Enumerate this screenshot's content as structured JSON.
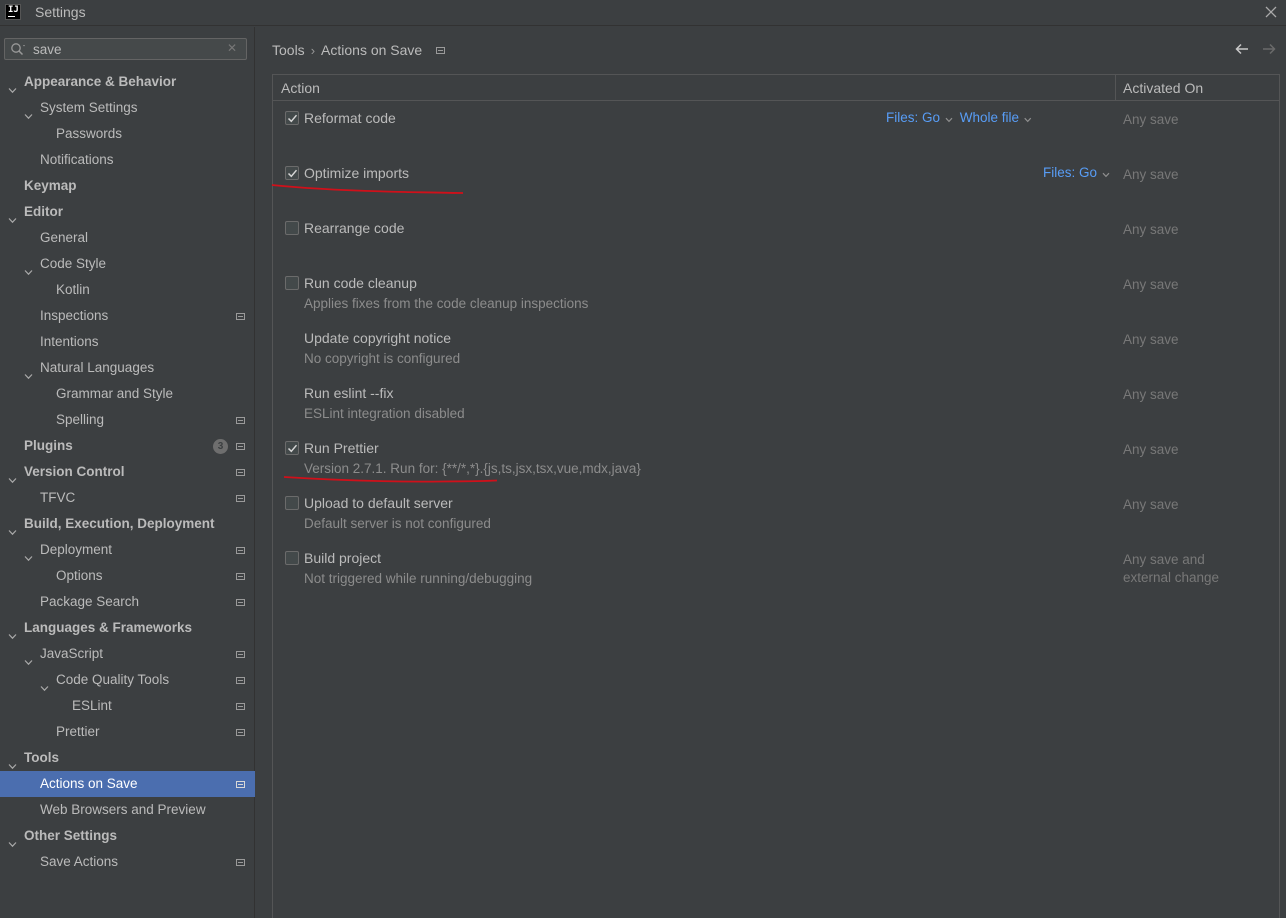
{
  "window": {
    "title": "Settings",
    "logo_text": "IJ"
  },
  "search": {
    "value": "save",
    "placeholder": ""
  },
  "tree": [
    {
      "label": "Appearance & Behavior",
      "level": 0,
      "arrow": "down",
      "bold": true
    },
    {
      "label": "System Settings",
      "level": 1,
      "arrow": "down"
    },
    {
      "label": "Passwords",
      "level": 2
    },
    {
      "label": "Notifications",
      "level": 1
    },
    {
      "label": "Keymap",
      "level": 0,
      "bold": true
    },
    {
      "label": "Editor",
      "level": 0,
      "arrow": "down",
      "bold": true
    },
    {
      "label": "General",
      "level": 1
    },
    {
      "label": "Code Style",
      "level": 1,
      "arrow": "down"
    },
    {
      "label": "Kotlin",
      "level": 2
    },
    {
      "label": "Inspections",
      "level": 1,
      "marker": true
    },
    {
      "label": "Intentions",
      "level": 1
    },
    {
      "label": "Natural Languages",
      "level": 1,
      "arrow": "down"
    },
    {
      "label": "Grammar and Style",
      "level": 2
    },
    {
      "label": "Spelling",
      "level": 2,
      "marker": true
    },
    {
      "label": "Plugins",
      "level": 0,
      "bold": true,
      "badge": "3",
      "marker": true
    },
    {
      "label": "Version Control",
      "level": 0,
      "arrow": "down",
      "bold": true,
      "marker": true
    },
    {
      "label": "TFVC",
      "level": 1,
      "marker": true
    },
    {
      "label": "Build, Execution, Deployment",
      "level": 0,
      "arrow": "down",
      "bold": true
    },
    {
      "label": "Deployment",
      "level": 1,
      "arrow": "down",
      "marker": true
    },
    {
      "label": "Options",
      "level": 2,
      "marker": true
    },
    {
      "label": "Package Search",
      "level": 1,
      "marker": true
    },
    {
      "label": "Languages & Frameworks",
      "level": 0,
      "arrow": "down",
      "bold": true
    },
    {
      "label": "JavaScript",
      "level": 1,
      "arrow": "down",
      "marker": true
    },
    {
      "label": "Code Quality Tools",
      "level": 2,
      "arrow": "down",
      "marker": true
    },
    {
      "label": "ESLint",
      "level": 3,
      "marker": true
    },
    {
      "label": "Prettier",
      "level": 2,
      "marker": true
    },
    {
      "label": "Tools",
      "level": 0,
      "arrow": "down",
      "bold": true
    },
    {
      "label": "Actions on Save",
      "level": 1,
      "marker": true,
      "selected": true
    },
    {
      "label": "Web Browsers and Preview",
      "level": 1
    },
    {
      "label": "Other Settings",
      "level": 0,
      "arrow": "down",
      "bold": true
    },
    {
      "label": "Save Actions",
      "level": 1,
      "marker": true
    }
  ],
  "breadcrumb": {
    "parent": "Tools",
    "current": "Actions on Save"
  },
  "table": {
    "col_action": "Action",
    "col_activated": "Activated On",
    "rows": [
      {
        "title": "Reformat code",
        "subtitle": "",
        "checkbox": true,
        "checked": true,
        "activated": "Any save",
        "dropdowns": [
          "Files: Go",
          "Whole file"
        ]
      },
      {
        "title": "Optimize imports",
        "subtitle": "",
        "checkbox": true,
        "checked": true,
        "activated": "Any save",
        "dropdowns": [
          "Files: Go"
        ]
      },
      {
        "title": "Rearrange code",
        "subtitle": "",
        "checkbox": true,
        "checked": false,
        "activated": "Any save",
        "dropdowns": []
      },
      {
        "title": "Run code cleanup",
        "subtitle": "Applies fixes from the code cleanup inspections",
        "checkbox": true,
        "checked": false,
        "activated": "Any save",
        "dropdowns": []
      },
      {
        "title": "Update copyright notice",
        "subtitle": "No copyright is configured",
        "checkbox": false,
        "checked": false,
        "activated": "Any save",
        "dropdowns": []
      },
      {
        "title": "Run eslint --fix",
        "subtitle": "ESLint integration disabled",
        "checkbox": false,
        "checked": false,
        "activated": "Any save",
        "dropdowns": []
      },
      {
        "title": "Run Prettier",
        "subtitle": "Version 2.7.1. Run for: {**/*,*}.{js,ts,jsx,tsx,vue,mdx,java}",
        "checkbox": true,
        "checked": true,
        "activated": "Any save",
        "dropdowns": []
      },
      {
        "title": "Upload to default server",
        "subtitle": "Default server is not configured",
        "checkbox": true,
        "checked": false,
        "activated": "Any save",
        "dropdowns": []
      },
      {
        "title": "Build project",
        "subtitle": "Not triggered while running/debugging",
        "checkbox": true,
        "checked": false,
        "activated_lines": [
          "Any save and",
          "external change"
        ],
        "dropdowns": []
      }
    ]
  },
  "colors": {
    "accent": "#4b6eaf",
    "link": "#589df6",
    "annotation": "#d0101a"
  }
}
